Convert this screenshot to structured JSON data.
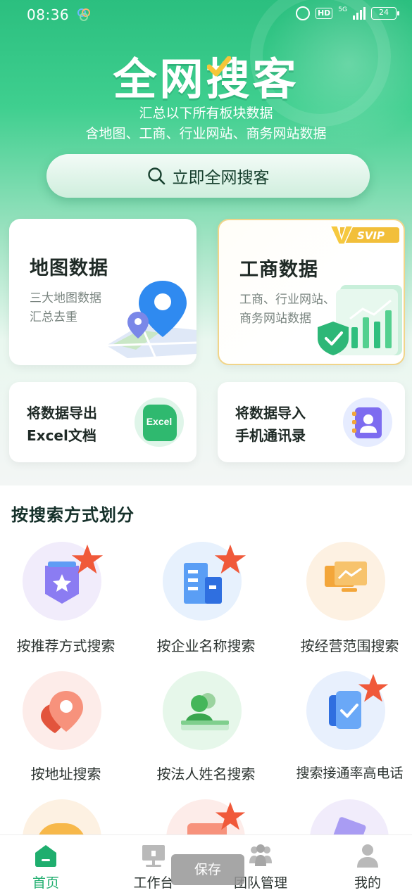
{
  "status": {
    "time": "08:36",
    "hd": "HD",
    "net": "5G",
    "battery": "24"
  },
  "hero": {
    "title": "全网搜客",
    "subtitle1": "汇总以下所有板块数据",
    "subtitle2": "含地图、工商、行业网站、商务网站数据",
    "search_label": "立即全网搜客"
  },
  "cards": {
    "map": {
      "title": "地图数据",
      "desc1": "三大地图数据",
      "desc2": "汇总去重"
    },
    "biz": {
      "title": "工商数据",
      "desc1": "工商、行业网站、",
      "desc2": "商务网站数据",
      "badge": "SVIP"
    }
  },
  "small_cards": {
    "excel": {
      "line1": "将数据导出",
      "line2": "Excel文档",
      "icon_text": "Excel"
    },
    "contacts": {
      "line1": "将数据导入",
      "line2": "手机通讯录"
    }
  },
  "section": {
    "title": "按搜索方式划分",
    "items": [
      {
        "label": "按推荐方式搜索",
        "icon": "recommend-icon",
        "star": true
      },
      {
        "label": "按企业名称搜索",
        "icon": "building-icon",
        "star": true
      },
      {
        "label": "按经营范围搜索",
        "icon": "screen-icon",
        "star": false
      },
      {
        "label": "按地址搜索",
        "icon": "location-icon",
        "star": false
      },
      {
        "label": "按法人姓名搜索",
        "icon": "person-icon",
        "star": false
      },
      {
        "label": "搜索接通率高电话",
        "icon": "phone-check-icon",
        "star": true
      }
    ]
  },
  "tabs": [
    {
      "label": "首页",
      "active": true
    },
    {
      "label": "工作台",
      "active": false
    },
    {
      "label": "团队管理",
      "active": false
    },
    {
      "label": "我的",
      "active": false
    }
  ],
  "toast": "保存",
  "colors": {
    "brand": "#2bbf7f",
    "active_tab": "#1fae6e",
    "star": "#f0593a",
    "gold": "#f3c243"
  }
}
